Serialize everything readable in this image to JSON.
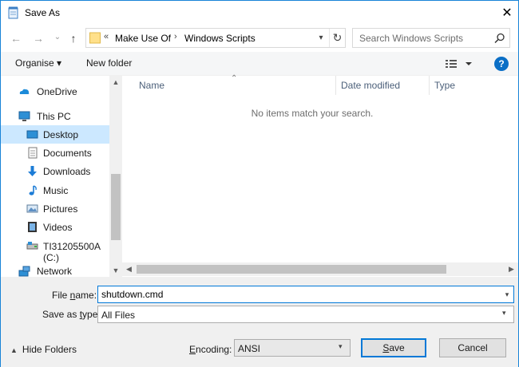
{
  "window": {
    "title": "Save As",
    "close_glyph": "✕"
  },
  "nav": {
    "back_glyph": "←",
    "forward_glyph": "→",
    "recent_glyph": "⌄",
    "up_glyph": "↑",
    "address": {
      "overflow": "«",
      "segments": [
        "Make Use Of",
        "Windows Scripts"
      ],
      "separator": "›"
    },
    "search_placeholder": "Search Windows Scripts"
  },
  "toolbar": {
    "organise": "Organise",
    "organise_arrow": "▾",
    "new_folder": "New folder",
    "help": "?"
  },
  "sidebar": {
    "items": [
      {
        "label": "OneDrive",
        "icon": "cloud-icon"
      },
      {
        "label": "This PC",
        "icon": "computer-icon"
      },
      {
        "label": "Desktop",
        "icon": "desktop-icon",
        "selected": true
      },
      {
        "label": "Documents",
        "icon": "documents-icon"
      },
      {
        "label": "Downloads",
        "icon": "downloads-icon"
      },
      {
        "label": "Music",
        "icon": "music-icon"
      },
      {
        "label": "Pictures",
        "icon": "pictures-icon"
      },
      {
        "label": "Videos",
        "icon": "videos-icon"
      },
      {
        "label": "TI31205500A (C:)",
        "icon": "drive-icon"
      },
      {
        "label": "Network",
        "icon": "network-icon"
      }
    ]
  },
  "files": {
    "columns": [
      "Name",
      "Date modified",
      "Type"
    ],
    "empty_message": "No items match your search."
  },
  "form": {
    "file_name_label_pre": "File ",
    "file_name_label_u": "n",
    "file_name_label_post": "ame:",
    "file_name_value": "shutdown.cmd",
    "save_type_label_pre": "Save as ",
    "save_type_label_u": "t",
    "save_type_label_post": "ype:",
    "save_type_value": "All Files",
    "hide_folders": "Hide Folders",
    "encoding_label_u": "E",
    "encoding_label_post": "ncoding:",
    "encoding_value": "ANSI",
    "save_u": "S",
    "save_post": "ave",
    "cancel": "Cancel"
  },
  "colors": {
    "accent": "#0078d7",
    "selected": "#cce8ff",
    "folder": "#ffd866"
  }
}
